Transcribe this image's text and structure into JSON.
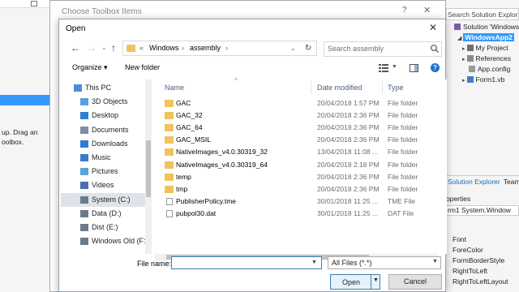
{
  "vs_left": {
    "hint_text": "up. Drag an\noolbox."
  },
  "solution_explorer": {
    "search_placeholder": "Search Solution Explore",
    "solution_label": "Solution 'Windows",
    "project_label": "WindowsApp2",
    "items": [
      "My Project",
      "References",
      "App.config",
      "Form1.vb"
    ],
    "tabs": [
      "Solution Explorer",
      "Team"
    ]
  },
  "properties": {
    "title": "operties",
    "object": "rm1 System.Window",
    "rows": [
      "Font",
      "ForeColor",
      "FormBorderStyle",
      "RightToLeft",
      "RightToLeftLayout"
    ]
  },
  "toolbox_dialog": {
    "title": "Choose Toolbox Items",
    "help": "?",
    "close": "✕"
  },
  "open_dialog": {
    "title": "Open",
    "close": "✕",
    "breadcrumb": [
      "«",
      "Windows",
      "›",
      "assembly",
      "›"
    ],
    "search_placeholder": "Search assembly",
    "organize_label": "Organize ▾",
    "new_folder_label": "New folder",
    "nav_items": [
      {
        "label": "This PC",
        "icon": "computer-icon"
      },
      {
        "label": "3D Objects",
        "icon": "cube-icon"
      },
      {
        "label": "Desktop",
        "icon": "desktop-icon"
      },
      {
        "label": "Documents",
        "icon": "documents-icon"
      },
      {
        "label": "Downloads",
        "icon": "download-icon"
      },
      {
        "label": "Music",
        "icon": "music-icon"
      },
      {
        "label": "Pictures",
        "icon": "pictures-icon"
      },
      {
        "label": "Videos",
        "icon": "videos-icon"
      },
      {
        "label": "System (C:)",
        "icon": "drive-icon"
      },
      {
        "label": "Data (D:)",
        "icon": "drive-icon"
      },
      {
        "label": "Dist (E:)",
        "icon": "drive-icon"
      },
      {
        "label": "Windows Old (F:",
        "icon": "drive-icon"
      }
    ],
    "selected_nav_index": 8,
    "columns": {
      "name": "Name",
      "date": "Date modified",
      "type": "Type"
    },
    "files": [
      {
        "name": "GAC",
        "date": "20/04/2018 1:57 PM",
        "type": "File folder",
        "kind": "folder"
      },
      {
        "name": "GAC_32",
        "date": "20/04/2018 2:36 PM",
        "type": "File folder",
        "kind": "folder"
      },
      {
        "name": "GAC_64",
        "date": "20/04/2018 2:36 PM",
        "type": "File folder",
        "kind": "folder"
      },
      {
        "name": "GAC_MSIL",
        "date": "20/04/2018 2:36 PM",
        "type": "File folder",
        "kind": "folder"
      },
      {
        "name": "NativeImages_v4.0.30319_32",
        "date": "13/04/2018 11:08 ...",
        "type": "File folder",
        "kind": "folder"
      },
      {
        "name": "NativeImages_v4.0.30319_64",
        "date": "20/04/2018 2:18 PM",
        "type": "File folder",
        "kind": "folder"
      },
      {
        "name": "temp",
        "date": "20/04/2018 2:36 PM",
        "type": "File folder",
        "kind": "folder"
      },
      {
        "name": "tmp",
        "date": "20/04/2018 2:36 PM",
        "type": "File folder",
        "kind": "folder"
      },
      {
        "name": "PublisherPolicy.tme",
        "date": "30/01/2018 11:25 ...",
        "type": "TME File",
        "kind": "file"
      },
      {
        "name": "pubpol30.dat",
        "date": "30/01/2018 11:25 ...",
        "type": "DAT File",
        "kind": "file"
      }
    ],
    "file_name_label": "File name:",
    "file_name_value": "",
    "file_type_value": "All Files (*.*)",
    "open_label": "Open",
    "cancel_label": "Cancel"
  },
  "colors": {
    "accent": "#3399ff",
    "folder": "#f0c35b",
    "selection": "#dfe3e9"
  }
}
